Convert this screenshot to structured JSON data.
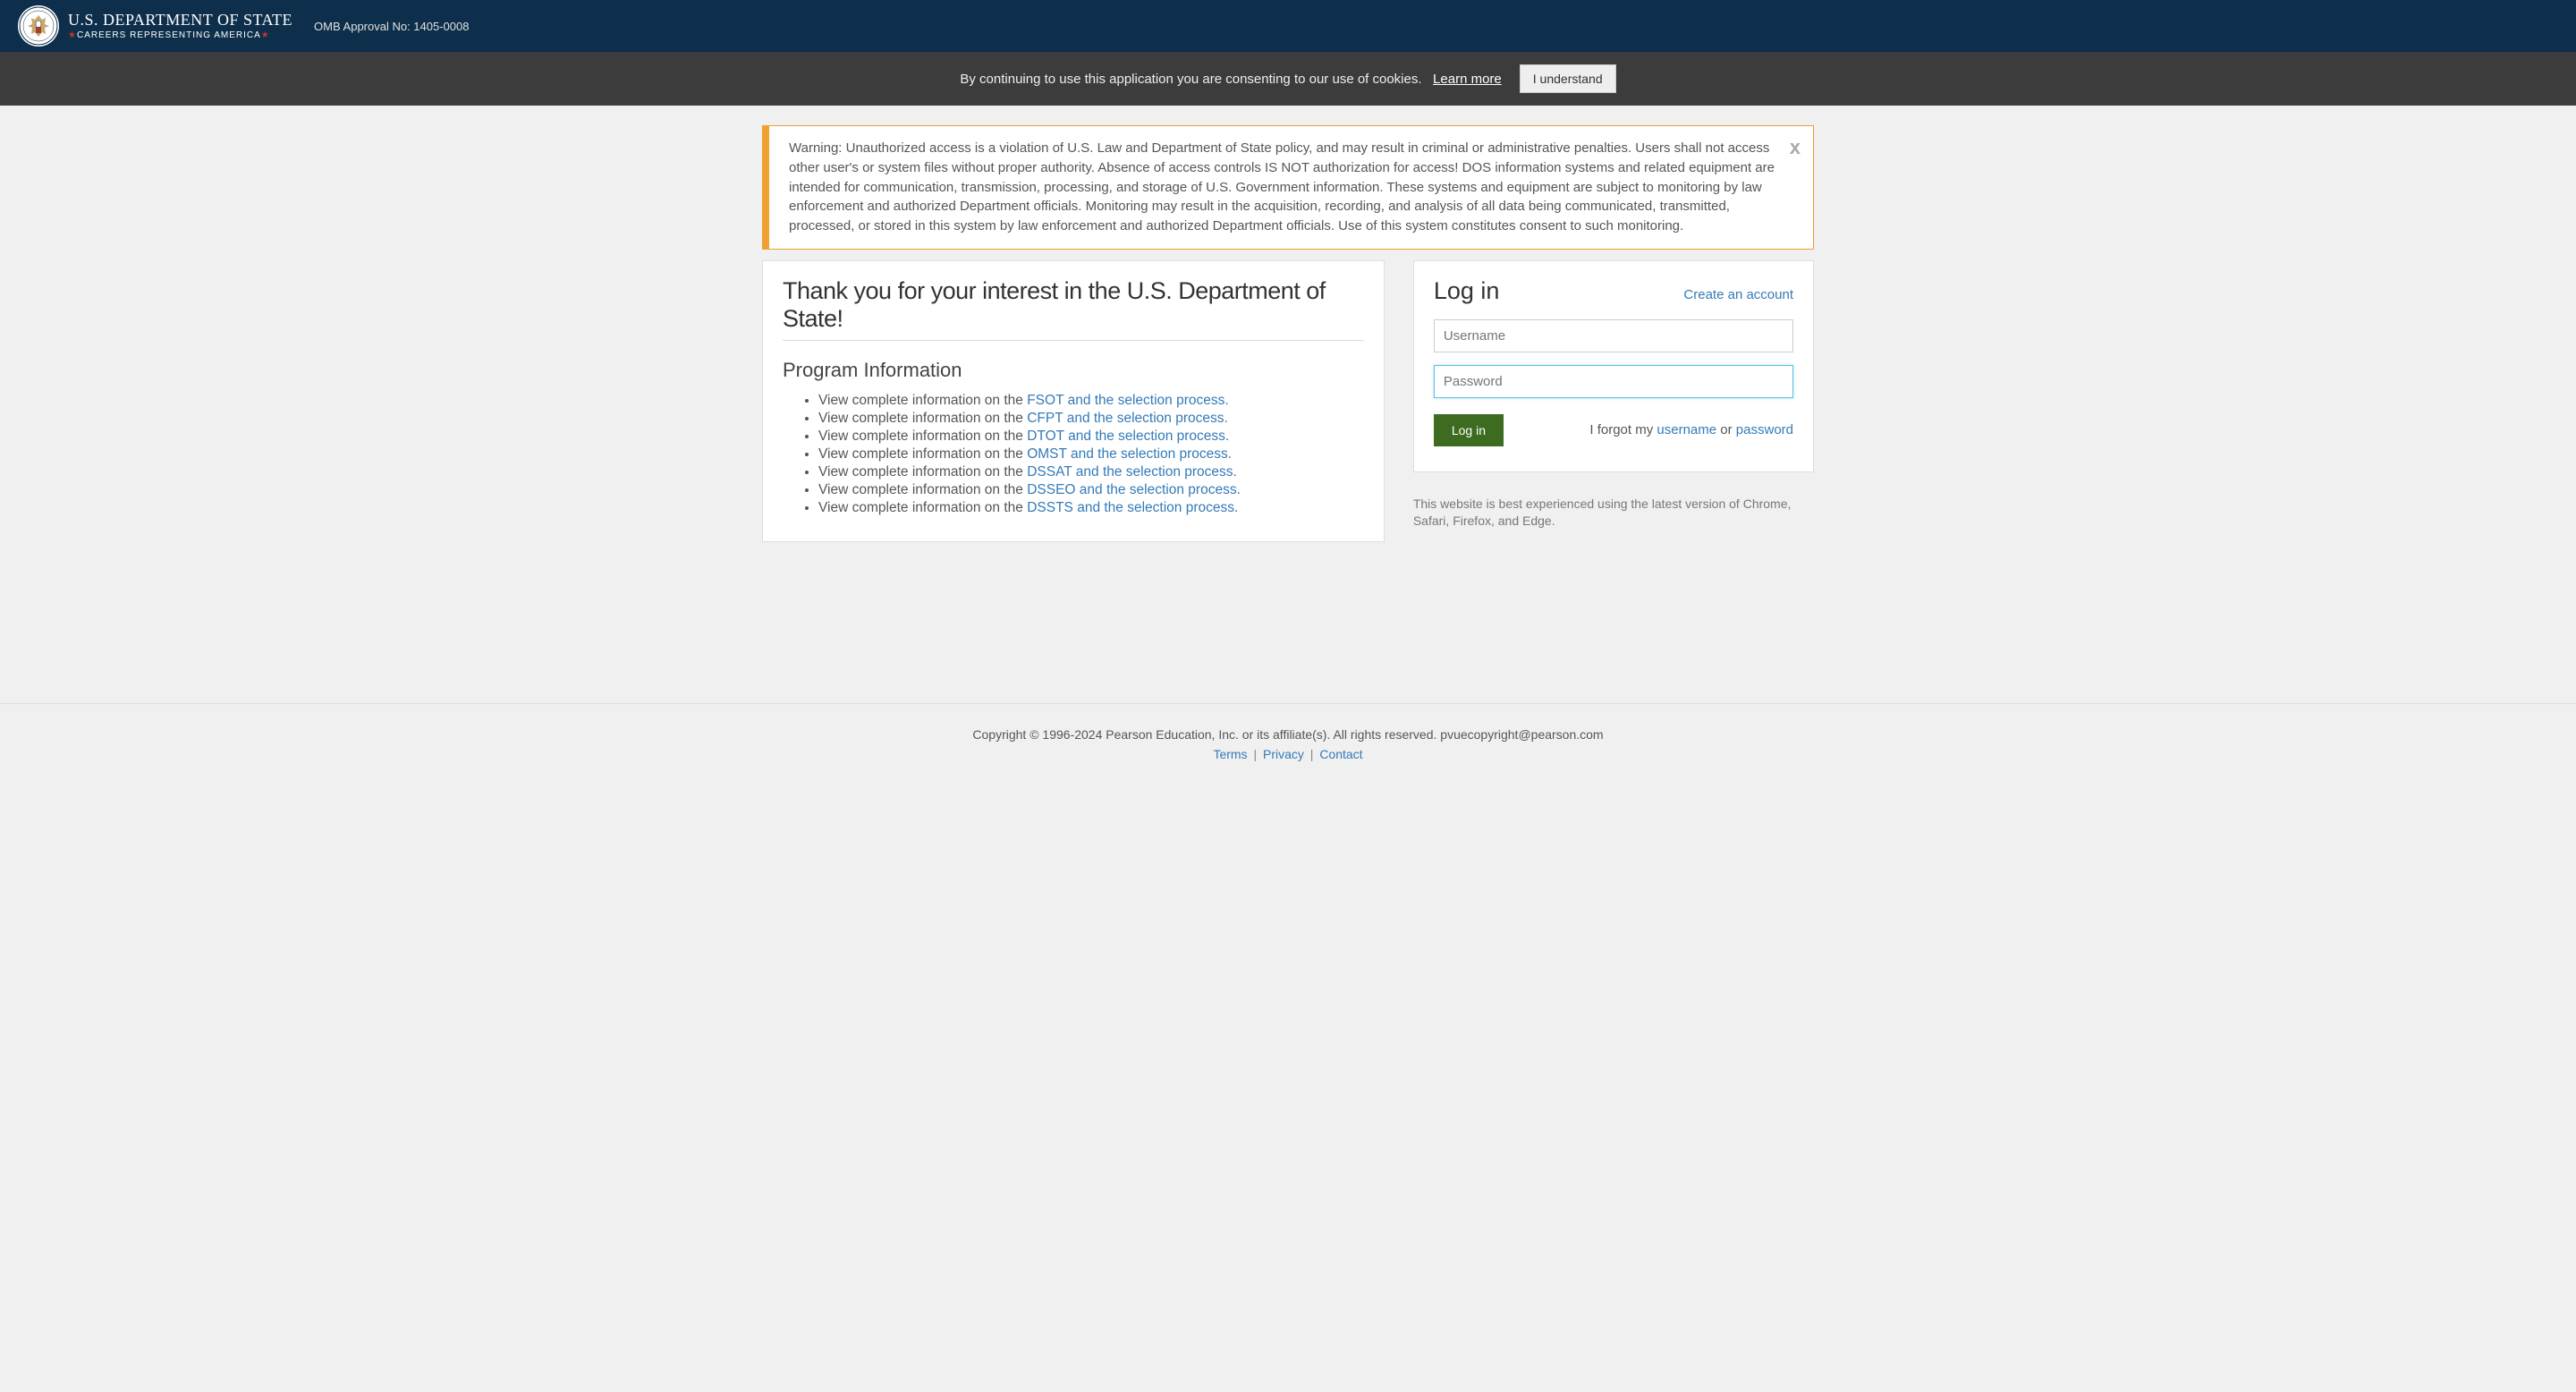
{
  "header": {
    "dept_main": "U.S. DEPARTMENT OF STATE",
    "dept_sub_pre": "CAREERS REPRESENTING AMERICA",
    "omb": "OMB Approval No: 1405-0008"
  },
  "cookie": {
    "text": "By continuing to use this application you are consenting to our use of cookies.",
    "learn_more": "Learn more",
    "understand": "I understand"
  },
  "warning": {
    "text": "Warning: Unauthorized access is a violation of U.S. Law and Department of State policy, and may result in criminal or administrative penalties. Users shall not access other user's or system files without proper authority. Absence of access controls IS NOT authorization for access! DOS information systems and related equipment are intended for communication, transmission, processing, and storage of U.S. Government information. These systems and equipment are subject to monitoring by law enforcement and authorized Department officials. Monitoring may result in the acquisition, recording, and analysis of all data being communicated, transmitted, processed, or stored in this system by law enforcement and authorized Department officials. Use of this system constitutes consent to such monitoring.",
    "close": "x"
  },
  "main": {
    "welcome": "Thank you for your interest in the U.S. Department of State!",
    "program_heading": "Program Information",
    "item_prefix": "View complete information on the ",
    "programs": [
      "FSOT and the selection process.",
      "CFPT and the selection process.",
      "DTOT and the selection process.",
      "OMST and the selection process.",
      "DSSAT and the selection process.",
      "DSSEO and the selection process.",
      "DSSTS and the selection process."
    ]
  },
  "login": {
    "title": "Log in",
    "create": "Create an account",
    "username_placeholder": "Username",
    "password_placeholder": "Password",
    "button": "Log in",
    "forgot_prefix": "I forgot my ",
    "forgot_username": "username",
    "forgot_or": " or ",
    "forgot_password": "password"
  },
  "browser_note": "This website is best experienced using the latest version of Chrome, Safari, Firefox, and Edge.",
  "footer": {
    "copyright": "Copyright © 1996-2024 Pearson Education, Inc. or its affiliate(s). All rights reserved. pvuecopyright@pearson.com",
    "terms": "Terms",
    "privacy": "Privacy",
    "contact": "Contact",
    "sep": " | "
  }
}
